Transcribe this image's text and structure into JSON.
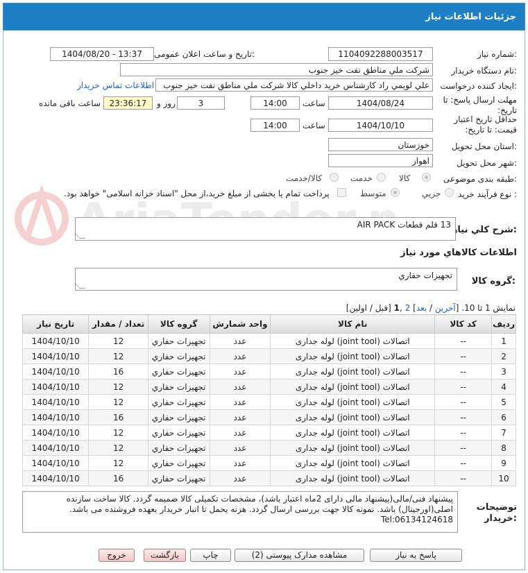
{
  "header": {
    "title": "جزئیات اطلاعات نیاز"
  },
  "labels": {
    "need_number": "شماره نیاز:",
    "announce_datetime": "تاریخ و ساعت اعلان عمومی:",
    "buyer_org": "نام دستگاه خریدار:",
    "requester": "ایجاد کننده درخواست:",
    "buyer_contact_link": "اطلاعات تماس خریدار",
    "reply_deadline": "مهلت ارسال پاسخ: تا تاریخ:",
    "time": "ساعت",
    "day_and": "روز و",
    "remaining": "ساعت باقی مانده",
    "price_validity": "حداقل تاریخ اعتبار قیمت: تا تاریخ:",
    "province": "استان محل تحویل:",
    "city": "شهر محل تحویل:",
    "category": "طبقه بندی موضوعی:",
    "process_type": "نوع فرآیند خرید :",
    "need_description": "شرح کلي نياز:",
    "goods_info": "اطلاعات کالاهاي مورد نياز",
    "goods_group": "گروه کالا:",
    "buyer_notes": "توضیحات خریدار:"
  },
  "fields": {
    "need_number": "1104092288003517",
    "announce_datetime": "1404/08/20 - 13:37",
    "buyer_org": "شرکت ملي مناطق نفت خيز جنوب",
    "requester": "علي  لويمي راد  كارشناس خريد داخلي كالا شركت ملي مناطق نفت خيز جنوب",
    "reply_date": "1404/08/24",
    "reply_time": "14:00",
    "reply_days": "3",
    "remaining_time": "23:36:17",
    "validity_date": "1404/10/10",
    "validity_time": "14:00",
    "province": "خوزستان",
    "city": "اهواز",
    "need_description": "13 قلم قطعات AIR PACK",
    "goods_group": "تجهيزات حفاري",
    "buyer_notes_lines": [
      "پیشنهاد فنی/مالی(پیشنهاد مالی دارای 2ماه اعتبار باشد)، مشخصات تکمیلی کالا ضمیمه گردد. کالا ساخت سازنده",
      "اصلی(اورجینال) باشد. نمونه کالا جهت بررسی ارسال گردد. هزنه یحمل تا انبار خریدار بعهده فروشنده می باشد.",
      "Tel:06134124618"
    ]
  },
  "category_options": {
    "goods": "كالا",
    "service": "خدمت",
    "goods_service": "كالا/خدمت",
    "selected": "كالا"
  },
  "process_options": {
    "partial": "جزيي",
    "medium": "متوسط",
    "payment_note": "پرداخت تمام یا بخشی از مبلغ خرید،از محل \"اسناد خزانه اسلامی\" خواهد بود.",
    "selected": "جزيي"
  },
  "pagination": {
    "prefix": "نمایش 1 تا 10. [",
    "last": "آخرین",
    "sep": " / ",
    "next": "بعد",
    "mid": "] ",
    "page2": "2",
    "comma": " ,",
    "page1": "1",
    "suffix": " [قبل / اولین]"
  },
  "table": {
    "headers": [
      "ردیف",
      "کد کالا",
      "نام کالا",
      "واحد شمارش",
      "گروه کالا",
      "تعداد / مقدار",
      "تاریخ نیاز"
    ],
    "rows": [
      [
        "1",
        "--",
        "اتصالات (joint tool) لوله جداری",
        "عدد",
        "تجهيزات حفاري",
        "12",
        "1404/10/10"
      ],
      [
        "2",
        "--",
        "اتصالات (joint tool) لوله جداری",
        "عدد",
        "تجهيزات حفاري",
        "12",
        "1404/10/10"
      ],
      [
        "3",
        "--",
        "اتصالات (joint tool) لوله جداری",
        "عدد",
        "تجهيزات حفاري",
        "16",
        "1404/10/10"
      ],
      [
        "4",
        "--",
        "اتصالات (joint tool) لوله جداری",
        "عدد",
        "تجهيزات حفاري",
        "12",
        "1404/10/10"
      ],
      [
        "5",
        "--",
        "اتصالات (joint tool) لوله جداری",
        "عدد",
        "تجهيزات حفاري",
        "12",
        "1404/10/10"
      ],
      [
        "6",
        "--",
        "اتصالات (joint tool) لوله جداری",
        "عدد",
        "تجهيزات حفاري",
        "16",
        "1404/10/10"
      ],
      [
        "7",
        "--",
        "اتصالات (joint tool) لوله جداری",
        "عدد",
        "تجهيزات حفاري",
        "12",
        "1404/10/10"
      ],
      [
        "8",
        "--",
        "اتصالات (joint tool) لوله جداری",
        "عدد",
        "تجهيزات حفاري",
        "12",
        "1404/10/10"
      ],
      [
        "9",
        "--",
        "اتصالات (joint tool) لوله جداری",
        "عدد",
        "تجهيزات حفاري",
        "12",
        "1404/10/10"
      ],
      [
        "10",
        "--",
        "اتصالات (joint tool) لوله جداری",
        "عدد",
        "تجهيزات حفاري",
        "16",
        "1404/10/10"
      ]
    ]
  },
  "buttons": {
    "reply": "پاسخ به نیاز",
    "view_docs": "مشاهده مدارک پیوستی (2)",
    "print": "چاپ",
    "back": "بازگشت",
    "exit": "خروج"
  },
  "watermark": {
    "text": "AriaTender.net"
  },
  "colors": {
    "header": "#1f7fc4",
    "link": "#1a62c8",
    "remaining_bg": "#fffec8",
    "pink_button": "#f3c7c7"
  }
}
